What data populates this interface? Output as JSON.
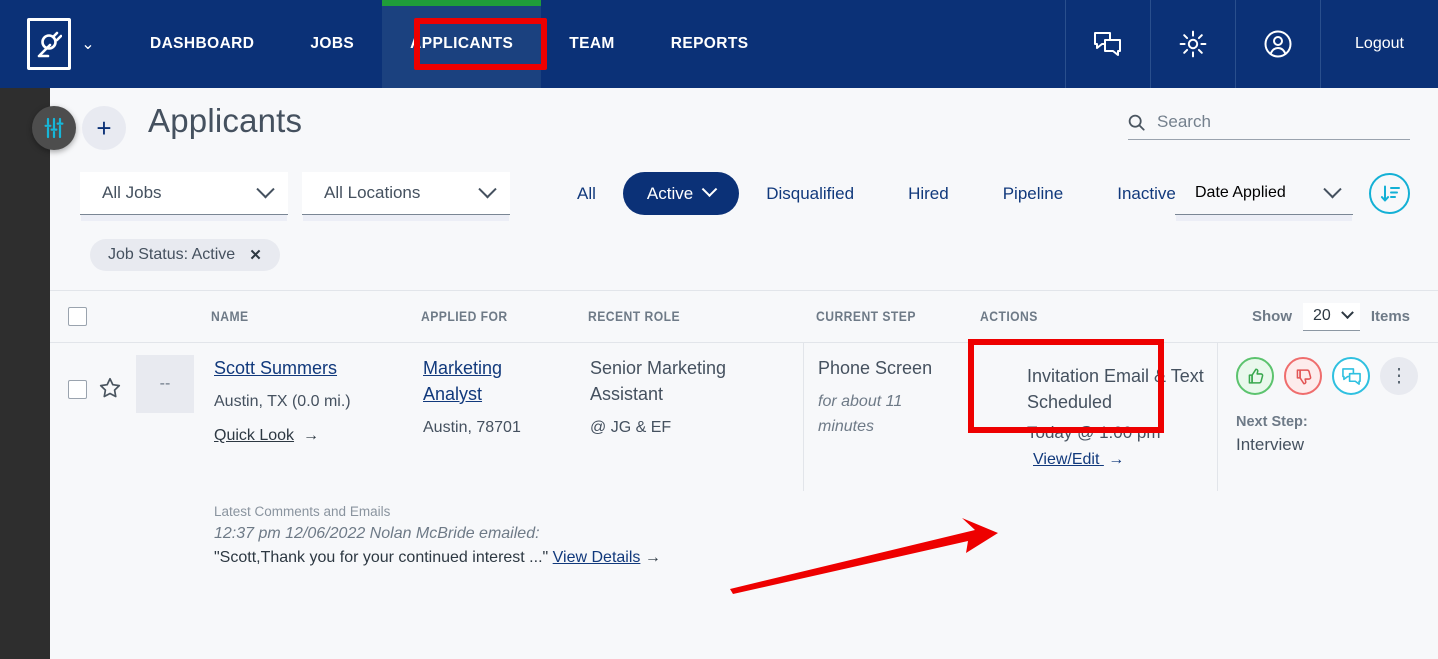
{
  "nav": {
    "logo_icon": "plug-logo-icon",
    "logo_caret_icon": "chevron-down-icon",
    "items": [
      {
        "label": "DASHBOARD",
        "active": false
      },
      {
        "label": "JOBS",
        "active": false
      },
      {
        "label": "APPLICANTS",
        "active": true
      },
      {
        "label": "TEAM",
        "active": false
      },
      {
        "label": "REPORTS",
        "active": false
      }
    ],
    "icons": [
      {
        "name": "messages-icon"
      },
      {
        "name": "gear-icon"
      },
      {
        "name": "user-account-icon"
      }
    ],
    "logout_label": "Logout",
    "active_color": "#1b417f",
    "bar_color": "#0b3177",
    "accent_green": "#1f9d3a"
  },
  "page": {
    "title": "Applicants",
    "filters_button_icon": "sliders-icon",
    "add_button_label": "+"
  },
  "search": {
    "placeholder": "Search",
    "value": "",
    "icon": "search-icon"
  },
  "filters": {
    "jobs_select": "All Jobs",
    "locations_select": "All Locations",
    "tabs": [
      {
        "label": "All",
        "selected": false
      },
      {
        "label": "Active",
        "selected": true
      },
      {
        "label": "Disqualified",
        "selected": false
      },
      {
        "label": "Hired",
        "selected": false
      },
      {
        "label": "Pipeline",
        "selected": false
      },
      {
        "label": "Inactive",
        "selected": false
      }
    ],
    "sort_select": "Date Applied",
    "sort_direction_icon": "sort-descending-icon"
  },
  "chips": [
    {
      "label": "Job Status: Active",
      "remove_icon": "close-icon"
    }
  ],
  "table": {
    "columns": [
      "NAME",
      "APPLIED FOR",
      "RECENT ROLE",
      "CURRENT STEP",
      "ACTIONS"
    ],
    "show_label": "Show",
    "show_value": "20",
    "items_label": "Items",
    "rows": [
      {
        "avatar_initials": "--",
        "name": "Scott Summers",
        "location": "Austin, TX (0.0 mi.)",
        "quick_look": "Quick Look",
        "applied_for": "Marketing Analyst",
        "applied_location": "Austin, 78701",
        "recent_role": "Senior Marketing Assistant",
        "recent_company": "@ JG & EF",
        "current_step": "Phone Screen",
        "current_step_duration": "for about 11 minutes",
        "action_status": "Invitation Email & Text Scheduled",
        "action_time": "Today @ 1:00 pm",
        "action_link": "View/Edit",
        "next_step_label": "Next Step:",
        "next_step_value": "Interview",
        "comments_heading": "Latest Comments and Emails",
        "comments_meta": "12:37 pm 12/06/2022 Nolan McBride emailed:",
        "comments_body": "\"Scott,Thank you for your continued interest ...\"",
        "comments_link": "View Details",
        "icons": [
          "thumbs-up-icon",
          "thumbs-down-icon",
          "chat-icon",
          "more-options-icon"
        ]
      }
    ]
  },
  "annotations": {
    "highlight_color": "#ee0000",
    "nav_highlight_target": "APPLICANTS",
    "action_highlight_target": "Invitation Email & Text Scheduled",
    "arrow_points_to": "View/Edit"
  }
}
